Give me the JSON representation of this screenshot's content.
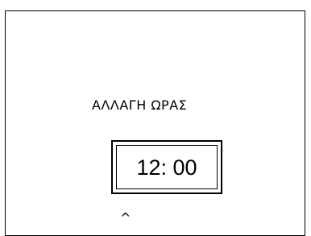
{
  "screen": {
    "title": "ΑΛΛΑΓΗ ΩΡΑΣ",
    "time_display": "12: 00",
    "cursor_indicator": "^"
  }
}
